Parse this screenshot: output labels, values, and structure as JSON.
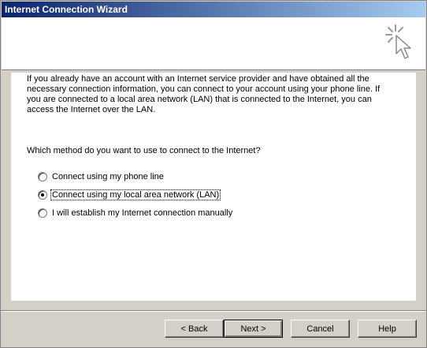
{
  "window": {
    "title": "Internet Connection Wizard"
  },
  "content": {
    "intro": "If you already have an account with an Internet service provider and have obtained all the necessary connection information, you can connect to your account using your phone line. If you are connected to a local area network (LAN) that is connected to the Internet, you can access the Internet over the LAN.",
    "question": "Which method do you want to use to connect to the Internet?",
    "options": [
      {
        "label": "Connect using my phone line",
        "selected": false
      },
      {
        "label": "Connect using my local area network (LAN)",
        "selected": true
      },
      {
        "label": "I will establish my Internet connection manually",
        "selected": false
      }
    ]
  },
  "buttons": {
    "back": "< Back",
    "next": "Next >",
    "cancel": "Cancel",
    "help": "Help"
  },
  "icons": {
    "header": "wizard-cursor-icon"
  }
}
